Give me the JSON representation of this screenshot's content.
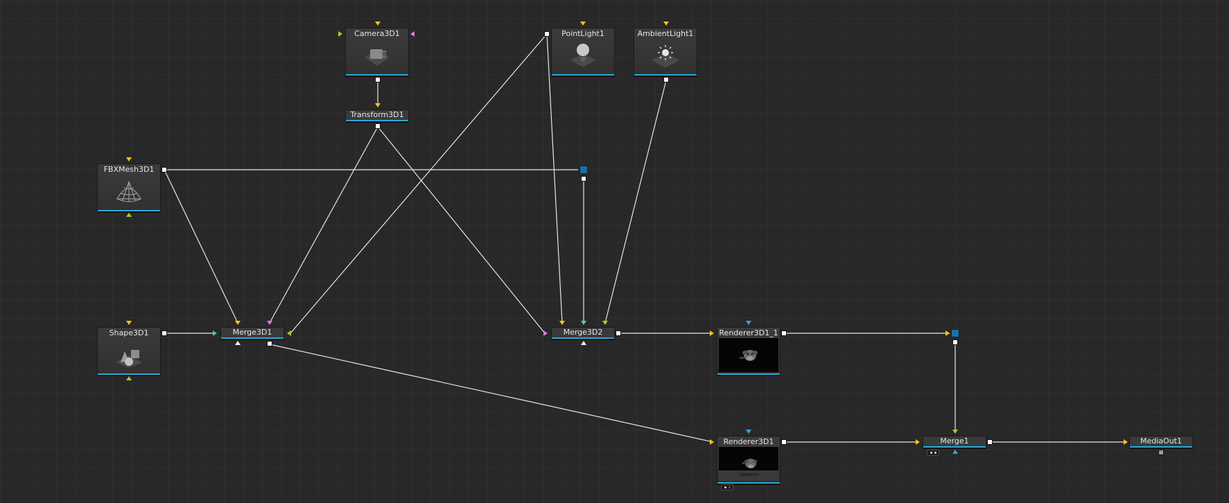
{
  "colors": {
    "background": "#282828",
    "wire": "#e8e8e8",
    "node_bg": "#3a3a3a",
    "node_underline": "#2aa6d6",
    "router": "#1d6fa2",
    "input_yellow": "#f5c518",
    "input_pink": "#e07ad6",
    "input_green": "#9ed12a",
    "input_cyan": "#34d1c1",
    "input_blue": "#2fa7e0",
    "input_white": "#f0f0f0",
    "input_teal": "#4fd2c0"
  },
  "nodes": {
    "camera3d1": {
      "label": "Camera3D1",
      "icon": "camera-icon"
    },
    "transform3d1": {
      "label": "Transform3D1"
    },
    "pointlight1": {
      "label": "PointLight1",
      "icon": "point-light-icon"
    },
    "ambientlight1": {
      "label": "AmbientLight1",
      "icon": "ambient-light-icon"
    },
    "fbxmesh3d1": {
      "label": "FBXMesh3D1",
      "icon": "mesh-icon"
    },
    "shape3d1": {
      "label": "Shape3D1",
      "icon": "shapes-icon"
    },
    "merge3d1": {
      "label": "Merge3D1"
    },
    "merge3d2": {
      "label": "Merge3D2"
    },
    "renderer3d1_1": {
      "label": "Renderer3D1_1",
      "thumbnail": "rendered-monkey-thumbnail"
    },
    "renderer3d1": {
      "label": "Renderer3D1",
      "thumbnail": "rendered-monkey-floor-thumbnail"
    },
    "merge1": {
      "label": "Merge1"
    },
    "mediaout1": {
      "label": "MediaOut1"
    }
  },
  "routers": [
    "router-1",
    "router-2"
  ]
}
